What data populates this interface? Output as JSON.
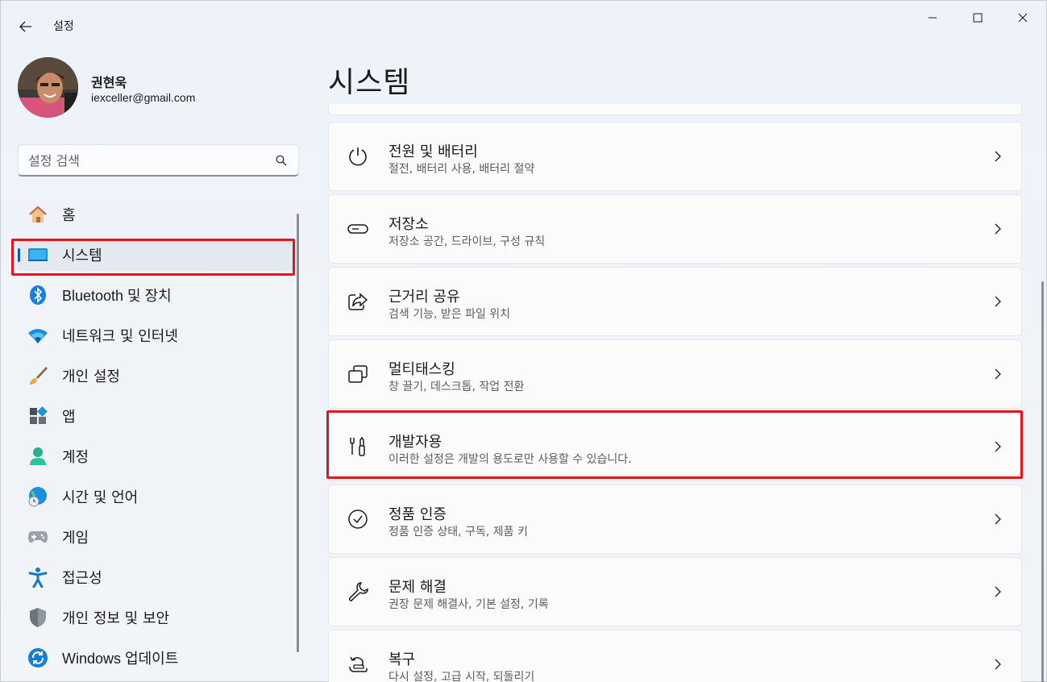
{
  "window": {
    "title": "설정"
  },
  "profile": {
    "name": "권현욱",
    "email": "iexceller@gmail.com"
  },
  "search": {
    "placeholder": "설정 검색"
  },
  "nav": {
    "items": [
      {
        "label": "홈",
        "icon": "home-icon"
      },
      {
        "label": "시스템",
        "icon": "system-icon",
        "selected": true
      },
      {
        "label": "Bluetooth 및 장치",
        "icon": "bluetooth-icon"
      },
      {
        "label": "네트워크 및 인터넷",
        "icon": "wifi-icon"
      },
      {
        "label": "개인 설정",
        "icon": "brush-icon"
      },
      {
        "label": "앱",
        "icon": "apps-icon"
      },
      {
        "label": "계정",
        "icon": "account-icon"
      },
      {
        "label": "시간 및 언어",
        "icon": "globe-clock-icon"
      },
      {
        "label": "게임",
        "icon": "gamepad-icon"
      },
      {
        "label": "접근성",
        "icon": "accessibility-icon"
      },
      {
        "label": "개인 정보 및 보안",
        "icon": "shield-icon"
      },
      {
        "label": "Windows 업데이트",
        "icon": "update-icon"
      }
    ]
  },
  "main": {
    "title": "시스템",
    "cards": [
      {
        "title": "전원 및 배터리",
        "desc": "절전, 배터리 사용, 배터리 절약",
        "icon": "power-icon"
      },
      {
        "title": "저장소",
        "desc": "저장소 공간, 드라이브, 구성 규칙",
        "icon": "storage-icon"
      },
      {
        "title": "근거리 공유",
        "desc": "검색 기능, 받은 파일 위치",
        "icon": "share-icon"
      },
      {
        "title": "멀티태스킹",
        "desc": "창 끌기, 데스크톱, 작업 전환",
        "icon": "multitask-icon"
      },
      {
        "title": "개발자용",
        "desc": "이러한 설정은 개발의 용도로만 사용할 수 있습니다.",
        "icon": "developer-tools-icon"
      },
      {
        "title": "정품 인증",
        "desc": "정품 인증 상태, 구독, 제품 키",
        "icon": "activation-check-icon"
      },
      {
        "title": "문제 해결",
        "desc": "권장 문제 해결사, 기본 설정, 기록",
        "icon": "wrench-icon"
      },
      {
        "title": "복구",
        "desc": "다시 설정, 고급 시작, 되돌리기",
        "icon": "recovery-icon"
      }
    ]
  },
  "colors": {
    "accent": "#005fb8",
    "highlight": "#e8141c"
  }
}
